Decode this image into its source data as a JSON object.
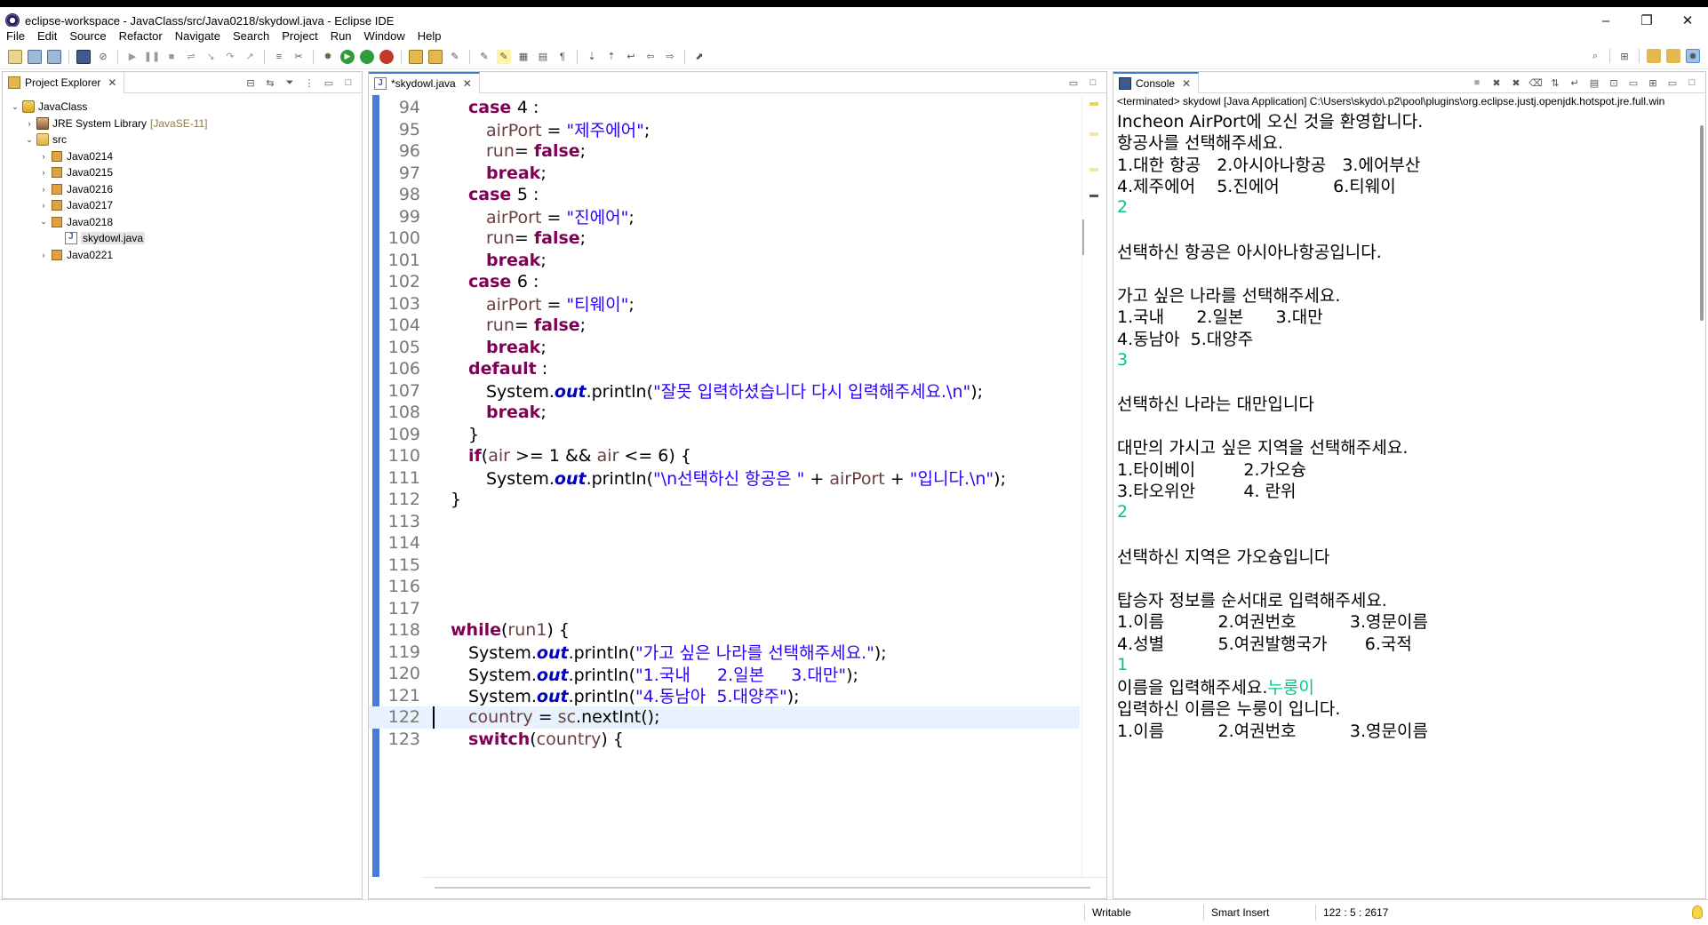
{
  "window": {
    "title": "eclipse-workspace - JavaClass/src/Java0218/skydowl.java - Eclipse IDE",
    "controls": {
      "minimize": "–",
      "maximize": "❐",
      "close": "✕"
    }
  },
  "menu": [
    "File",
    "Edit",
    "Source",
    "Refactor",
    "Navigate",
    "Search",
    "Project",
    "Run",
    "Window",
    "Help"
  ],
  "explorer": {
    "tab_label": "Project Explorer",
    "tree": [
      {
        "label": "JavaClass",
        "depth": 0,
        "expanded": true,
        "icon": "project-icon"
      },
      {
        "label": "JRE System Library",
        "suffix": "[JavaSE-11]",
        "depth": 1,
        "expanded": false,
        "icon": "library-icon"
      },
      {
        "label": "src",
        "depth": 1,
        "expanded": true,
        "icon": "source-folder-icon"
      },
      {
        "label": "Java0214",
        "depth": 2,
        "expanded": false,
        "icon": "package-icon"
      },
      {
        "label": "Java0215",
        "depth": 2,
        "expanded": false,
        "icon": "package-icon"
      },
      {
        "label": "Java0216",
        "depth": 2,
        "expanded": false,
        "icon": "package-icon"
      },
      {
        "label": "Java0217",
        "depth": 2,
        "expanded": false,
        "icon": "package-icon"
      },
      {
        "label": "Java0218",
        "depth": 2,
        "expanded": true,
        "icon": "package-icon"
      },
      {
        "label": "skydowl.java",
        "depth": 3,
        "expanded": false,
        "icon": "java-file-icon",
        "selected": true
      },
      {
        "label": "Java0221",
        "depth": 2,
        "expanded": false,
        "icon": "package-icon"
      }
    ]
  },
  "editor": {
    "tab_label": "*skydowl.java",
    "current_line": 122,
    "lines": [
      {
        "n": "94",
        "indent": 2,
        "tokens": [
          {
            "t": "kw",
            "v": "case "
          },
          {
            "t": "plain",
            "v": "4 :"
          }
        ]
      },
      {
        "n": "95",
        "indent": 3,
        "tokens": [
          {
            "t": "var",
            "v": "airPort"
          },
          {
            "t": "plain",
            "v": " = "
          },
          {
            "t": "str",
            "v": "\"제주에어\""
          },
          {
            "t": "plain",
            "v": ";"
          }
        ]
      },
      {
        "n": "96",
        "indent": 3,
        "tokens": [
          {
            "t": "var",
            "v": "run"
          },
          {
            "t": "plain",
            "v": "= "
          },
          {
            "t": "kw",
            "v": "false"
          },
          {
            "t": "plain",
            "v": ";"
          }
        ]
      },
      {
        "n": "97",
        "indent": 3,
        "tokens": [
          {
            "t": "kw",
            "v": "break"
          },
          {
            "t": "plain",
            "v": ";"
          }
        ]
      },
      {
        "n": "98",
        "indent": 2,
        "tokens": [
          {
            "t": "kw",
            "v": "case "
          },
          {
            "t": "plain",
            "v": "5 :"
          }
        ]
      },
      {
        "n": "99",
        "indent": 3,
        "tokens": [
          {
            "t": "var",
            "v": "airPort"
          },
          {
            "t": "plain",
            "v": " = "
          },
          {
            "t": "str",
            "v": "\"진에어\""
          },
          {
            "t": "plain",
            "v": ";"
          }
        ]
      },
      {
        "n": "100",
        "indent": 3,
        "tokens": [
          {
            "t": "var",
            "v": "run"
          },
          {
            "t": "plain",
            "v": "= "
          },
          {
            "t": "kw",
            "v": "false"
          },
          {
            "t": "plain",
            "v": ";"
          }
        ]
      },
      {
        "n": "101",
        "indent": 3,
        "tokens": [
          {
            "t": "kw",
            "v": "break"
          },
          {
            "t": "plain",
            "v": ";"
          }
        ]
      },
      {
        "n": "102",
        "indent": 2,
        "tokens": [
          {
            "t": "kw",
            "v": "case "
          },
          {
            "t": "plain",
            "v": "6 :"
          }
        ]
      },
      {
        "n": "103",
        "indent": 3,
        "tokens": [
          {
            "t": "var",
            "v": "airPort"
          },
          {
            "t": "plain",
            "v": " = "
          },
          {
            "t": "str",
            "v": "\"티웨이\""
          },
          {
            "t": "plain",
            "v": ";"
          }
        ]
      },
      {
        "n": "104",
        "indent": 3,
        "tokens": [
          {
            "t": "var",
            "v": "run"
          },
          {
            "t": "plain",
            "v": "= "
          },
          {
            "t": "kw",
            "v": "false"
          },
          {
            "t": "plain",
            "v": ";"
          }
        ]
      },
      {
        "n": "105",
        "indent": 3,
        "tokens": [
          {
            "t": "kw",
            "v": "break"
          },
          {
            "t": "plain",
            "v": ";"
          }
        ]
      },
      {
        "n": "106",
        "indent": 2,
        "tokens": [
          {
            "t": "kw",
            "v": "default"
          },
          {
            "t": "plain",
            "v": " :"
          }
        ]
      },
      {
        "n": "107",
        "indent": 3,
        "tokens": [
          {
            "t": "plain",
            "v": "System."
          },
          {
            "t": "fld",
            "v": "out"
          },
          {
            "t": "plain",
            "v": ".println("
          },
          {
            "t": "str",
            "v": "\"잘못 입력하셨습니다 다시 입력해주세요.\\n\""
          },
          {
            "t": "plain",
            "v": ");"
          }
        ]
      },
      {
        "n": "108",
        "indent": 3,
        "tokens": [
          {
            "t": "kw",
            "v": "break"
          },
          {
            "t": "plain",
            "v": ";"
          }
        ]
      },
      {
        "n": "109",
        "indent": 2,
        "tokens": [
          {
            "t": "plain",
            "v": "}"
          }
        ]
      },
      {
        "n": "110",
        "indent": 2,
        "tokens": [
          {
            "t": "kw",
            "v": "if"
          },
          {
            "t": "plain",
            "v": "("
          },
          {
            "t": "var",
            "v": "air"
          },
          {
            "t": "plain",
            "v": " >= 1 && "
          },
          {
            "t": "var",
            "v": "air"
          },
          {
            "t": "plain",
            "v": " <= 6) {"
          }
        ]
      },
      {
        "n": "111",
        "indent": 3,
        "tokens": [
          {
            "t": "plain",
            "v": "System."
          },
          {
            "t": "fld",
            "v": "out"
          },
          {
            "t": "plain",
            "v": ".println("
          },
          {
            "t": "str",
            "v": "\"\\n선택하신 항공은 \""
          },
          {
            "t": "plain",
            "v": " + "
          },
          {
            "t": "var",
            "v": "airPort"
          },
          {
            "t": "plain",
            "v": " + "
          },
          {
            "t": "str",
            "v": "\"입니다.\\n\""
          },
          {
            "t": "plain",
            "v": ");"
          }
        ]
      },
      {
        "n": "112",
        "indent": 1,
        "tokens": [
          {
            "t": "plain",
            "v": "}"
          }
        ]
      },
      {
        "n": "113",
        "indent": 0,
        "tokens": []
      },
      {
        "n": "114",
        "indent": 0,
        "tokens": []
      },
      {
        "n": "115",
        "indent": 0,
        "tokens": []
      },
      {
        "n": "116",
        "indent": 0,
        "tokens": []
      },
      {
        "n": "117",
        "indent": 0,
        "tokens": []
      },
      {
        "n": "118",
        "indent": 1,
        "tokens": [
          {
            "t": "kw",
            "v": "while"
          },
          {
            "t": "plain",
            "v": "("
          },
          {
            "t": "var",
            "v": "run1"
          },
          {
            "t": "plain",
            "v": ") {"
          }
        ]
      },
      {
        "n": "119",
        "indent": 2,
        "tokens": [
          {
            "t": "plain",
            "v": "System."
          },
          {
            "t": "fld",
            "v": "out"
          },
          {
            "t": "plain",
            "v": ".println("
          },
          {
            "t": "str",
            "v": "\"가고 싶은 나라를 선택해주세요.\""
          },
          {
            "t": "plain",
            "v": ");"
          }
        ]
      },
      {
        "n": "120",
        "indent": 2,
        "tokens": [
          {
            "t": "plain",
            "v": "System."
          },
          {
            "t": "fld",
            "v": "out"
          },
          {
            "t": "plain",
            "v": ".println("
          },
          {
            "t": "str",
            "v": "\"1.국내     2.일본     3.대만\""
          },
          {
            "t": "plain",
            "v": ");"
          }
        ]
      },
      {
        "n": "121",
        "indent": 2,
        "tokens": [
          {
            "t": "plain",
            "v": "System."
          },
          {
            "t": "fld",
            "v": "out"
          },
          {
            "t": "plain",
            "v": ".println("
          },
          {
            "t": "str",
            "v": "\"4.동남아  5.대양주\""
          },
          {
            "t": "plain",
            "v": ");"
          }
        ]
      },
      {
        "n": "122",
        "indent": 2,
        "tokens": [
          {
            "t": "var",
            "v": "country"
          },
          {
            "t": "plain",
            "v": " = "
          },
          {
            "t": "var",
            "v": "sc"
          },
          {
            "t": "plain",
            "v": ".nextInt();"
          }
        ]
      },
      {
        "n": "123",
        "indent": 2,
        "tokens": [
          {
            "t": "kw",
            "v": "switch"
          },
          {
            "t": "plain",
            "v": "("
          },
          {
            "t": "var",
            "v": "country"
          },
          {
            "t": "plain",
            "v": ") {"
          }
        ]
      }
    ]
  },
  "console": {
    "tab_label": "Console",
    "header": "<terminated> skydowl [Java Application] C:\\Users\\skydo\\.p2\\pool\\plugins\\org.eclipse.justj.openjdk.hotspot.jre.full.win",
    "lines": [
      {
        "text": "Incheon AirPort에 오신 것을 환영합니다.",
        "input": ""
      },
      {
        "text": "항공사를 선택해주세요.",
        "input": ""
      },
      {
        "text": "1.대한 항공   2.아시아나항공   3.에어부산",
        "input": ""
      },
      {
        "text": "4.제주에어    5.진에어          6.티웨이",
        "input": ""
      },
      {
        "text": "",
        "input": "2"
      },
      {
        "text": "",
        "input": ""
      },
      {
        "text": "선택하신 항공은 아시아나항공입니다.",
        "input": ""
      },
      {
        "text": "",
        "input": ""
      },
      {
        "text": "가고 싶은 나라를 선택해주세요.",
        "input": ""
      },
      {
        "text": "1.국내      2.일본      3.대만",
        "input": ""
      },
      {
        "text": "4.동남아  5.대양주",
        "input": ""
      },
      {
        "text": "",
        "input": "3"
      },
      {
        "text": "",
        "input": ""
      },
      {
        "text": "선택하신 나라는 대만입니다",
        "input": ""
      },
      {
        "text": "",
        "input": ""
      },
      {
        "text": "대만의 가시고 싶은 지역을 선택해주세요.",
        "input": ""
      },
      {
        "text": "1.타이베이         2.가오슝",
        "input": ""
      },
      {
        "text": "3.타오위안         4. 란위",
        "input": ""
      },
      {
        "text": "",
        "input": "2"
      },
      {
        "text": "",
        "input": ""
      },
      {
        "text": "선택하신 지역은 가오슝입니다",
        "input": ""
      },
      {
        "text": "",
        "input": ""
      },
      {
        "text": "탑승자 정보를 순서대로 입력해주세요.",
        "input": ""
      },
      {
        "text": "1.이름          2.여권번호          3.영문이름",
        "input": ""
      },
      {
        "text": "4.성별          5.여권발행국가       6.국적",
        "input": ""
      },
      {
        "text": "",
        "input": "1"
      },
      {
        "text": "이름을 입력해주세요.",
        "input": "누룽이"
      },
      {
        "text": "입력하신 이름은 누룽이 입니다.",
        "input": ""
      },
      {
        "text": "1.이름          2.여권번호          3.영문이름",
        "input": ""
      }
    ]
  },
  "status": {
    "writable": "Writable",
    "insert_mode": "Smart Insert",
    "position": "122 : 5 : 2617"
  },
  "colors": {
    "keyword": "#7f0055",
    "string": "#2a00ff",
    "field": "#0000c0",
    "variable": "#6a3e3e",
    "console_input": "#00c87f",
    "ruler_blue": "#4a7bd6",
    "current_line": "#e8f2fe"
  }
}
